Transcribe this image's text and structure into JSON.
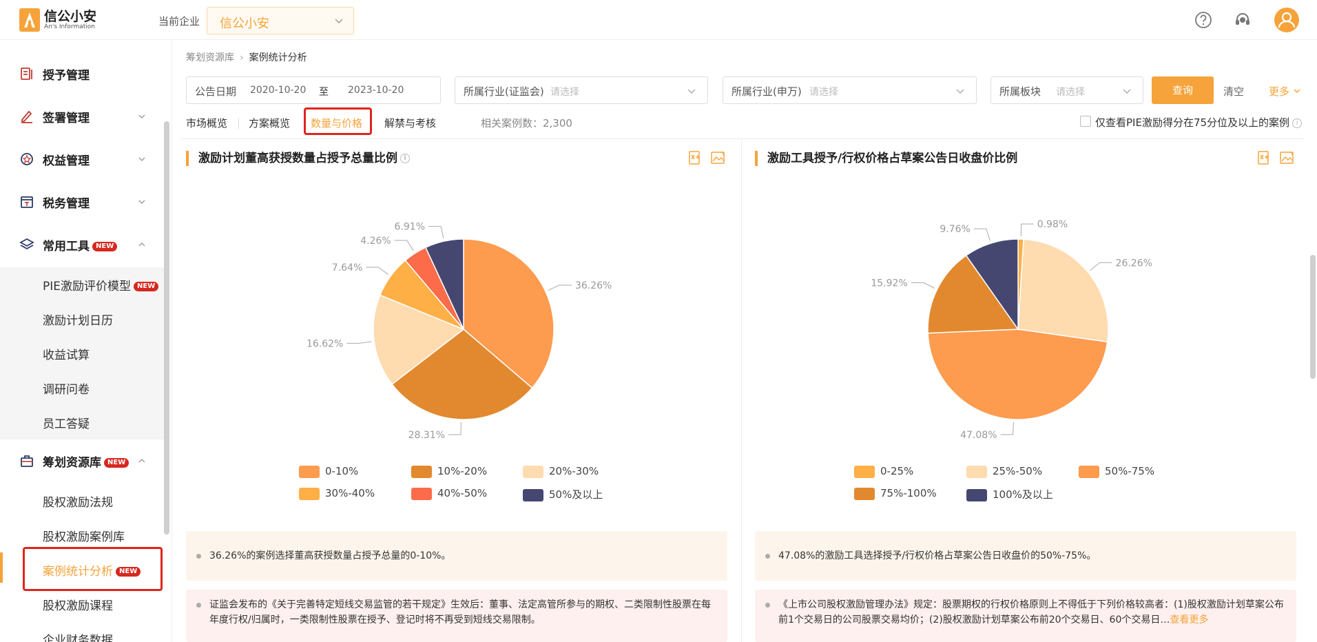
{
  "header": {
    "logo_cn": "信公小安",
    "logo_en": "An's Information",
    "company_label": "当前企业",
    "company_value": "信公小安"
  },
  "sidebar": {
    "items": [
      {
        "label": "授予管理",
        "icon": "document-icon"
      },
      {
        "label": "签署管理",
        "icon": "pen-icon"
      },
      {
        "label": "权益管理",
        "icon": "badge-icon"
      },
      {
        "label": "税务管理",
        "icon": "tax-icon"
      },
      {
        "label": "常用工具",
        "icon": "layers-icon",
        "badge": "NEW"
      },
      {
        "label": "筹划资源库",
        "icon": "briefcase-icon",
        "badge": "NEW"
      }
    ],
    "tools_sub": [
      {
        "label": "PIE激励评价模型",
        "badge": "NEW"
      },
      {
        "label": "激励计划日历"
      },
      {
        "label": "收益试算"
      },
      {
        "label": "调研问卷"
      },
      {
        "label": "员工答疑"
      }
    ],
    "resource_sub": [
      {
        "label": "股权激励法规"
      },
      {
        "label": "股权激励案例库"
      },
      {
        "label": "案例统计分析",
        "badge": "NEW"
      },
      {
        "label": "股权激励课程"
      },
      {
        "label": "企业财务数据"
      }
    ]
  },
  "breadcrumb": {
    "parent": "筹划资源库",
    "current": "案例统计分析"
  },
  "filters": {
    "date_label": "公告日期",
    "date_from": "2020-10-20",
    "date_to_label": "至",
    "date_to": "2023-10-20",
    "industry_csrc_label": "所属行业(证监会)",
    "industry_sw_label": "所属行业(申万)",
    "board_label": "所属板块",
    "placeholder": "请选择",
    "query_button": "查询",
    "clear_button": "清空",
    "more_button": "更多"
  },
  "tabs": [
    "市场概览",
    "方案概览",
    "数量与价格",
    "解禁与考核"
  ],
  "active_tab": "数量与价格",
  "case_count": "相关案例数：2,300",
  "checkbox_label": "仅查看PIE激励得分在75分位及以上的案例",
  "chart_data": [
    {
      "type": "pie",
      "title": "激励计划董高获授数量占授予总量比例",
      "labels": [
        "0-10%",
        "10%-20%",
        "20%-30%",
        "30%-40%",
        "40%-50%",
        "50%及以上"
      ],
      "values": [
        36.26,
        28.31,
        16.62,
        7.64,
        4.26,
        6.91
      ],
      "data_labels": [
        "36.26%",
        "28.31%",
        "16.62%",
        "7.64%",
        "4.26%",
        "6.91%"
      ],
      "colors": [
        "#fd9b4f",
        "#e2892f",
        "#ffdbb0",
        "#feaf46",
        "#fc6c4a",
        "#464771"
      ],
      "legend": "bottom"
    },
    {
      "type": "pie",
      "title": "激励工具授予/行权价格占草案公告日收盘价比例",
      "labels": [
        "0-25%",
        "25%-50%",
        "50%-75%",
        "75%-100%",
        "100%及以上"
      ],
      "values": [
        0.98,
        26.26,
        47.08,
        15.92,
        9.76
      ],
      "data_labels": [
        "0.98%",
        "26.26%",
        "47.08%",
        "15.92%",
        "9.76%"
      ],
      "colors": [
        "#feaf46",
        "#ffdbb0",
        "#fd9b4f",
        "#e2892f",
        "#464771"
      ],
      "legend": "bottom"
    }
  ],
  "notes": {
    "left_1": "36.26%的案例选择董高获授数量占授予总量的0-10%。",
    "left_2": "证监会发布的《关于完善特定短线交易监管的若干规定》生效后：董事、法定高管所参与的期权、二类限制性股票在每年度行权/归属时，一类限制性股票在授予、登记时将不再受到短线交易限制。",
    "right_1": "47.08%的激励工具选择授予/行权价格占草案公告日收盘价的50%-75%。",
    "right_2": "《上市公司股权激励管理办法》规定：股票期权的行权价格原则上不得低于下列价格较高者：(1)股权激励计划草案公布前1个交易日的公司股票交易均价；(2)股权激励计划草案公布前20个交易日、60个交易日…",
    "right_more": "查看更多"
  }
}
